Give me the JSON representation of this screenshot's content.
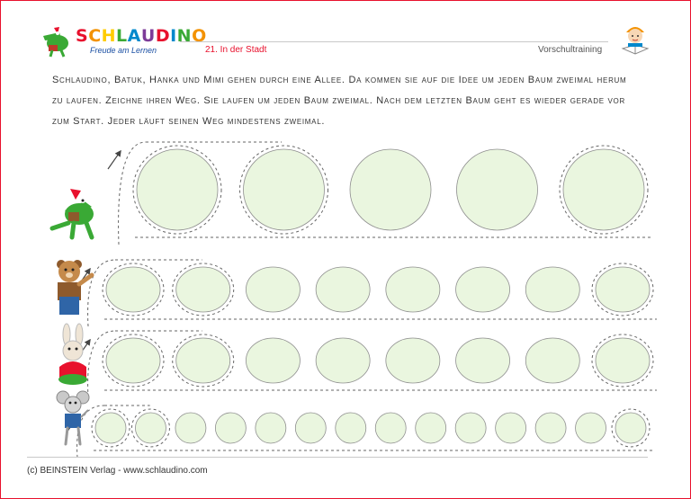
{
  "header": {
    "brand": "SCHLAUDINO",
    "brand_colors": [
      "#e8112d",
      "#f39200",
      "#ffcc00",
      "#3aa935",
      "#0088cc",
      "#7d3c98",
      "#e8112d",
      "#0088cc",
      "#3aa935",
      "#f39200"
    ],
    "tagline": "Freude am Lernen",
    "sheet_title": "21. In der Stadt",
    "category": "Vorschultraining"
  },
  "instructions": "Schlaudino, Batuk, Hanka und Mimi gehen durch eine Allee. Da kommen sie auf die Idee um jeden Baum zweimal herum zu laufen. Zeichne ihren Weg. Sie laufen um jeden Baum zweimal. Nach dem letzten Baum geht es wieder gerade vor zum Start. Jeder läuft seinen Weg mindestens zweimal.",
  "rows": [
    {
      "character_icon": "crocodile-icon",
      "tree_count": 5
    },
    {
      "character_icon": "bear-icon",
      "tree_count": 8
    },
    {
      "character_icon": "rabbit-icon",
      "tree_count": 8
    },
    {
      "character_icon": "mouse-icon",
      "tree_count": 14
    }
  ],
  "colors": {
    "frame": "#e8112d",
    "tree_fill": "#eaf6df",
    "tree_stroke": "#8f8f8f",
    "dash": "#666666",
    "title_red": "#e8112d"
  },
  "footer": {
    "copyright": "(c) BEINSTEIN Verlag - www.schlaudino.com"
  }
}
